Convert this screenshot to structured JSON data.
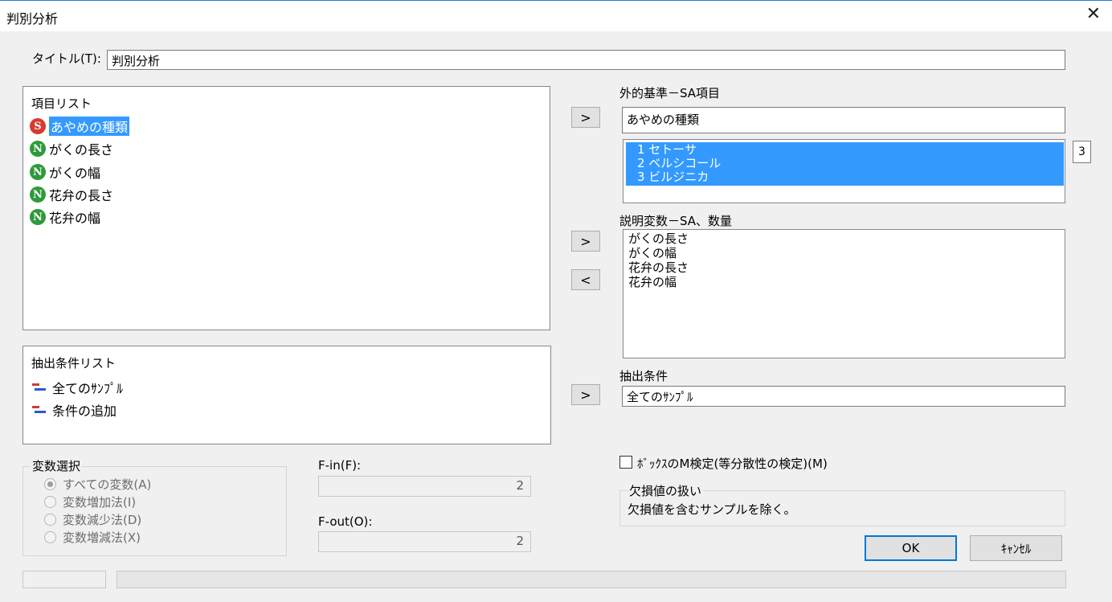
{
  "window": {
    "title": "判別分析",
    "close_glyph": "✕"
  },
  "title_field": {
    "label": "タイトル(T):",
    "value": "判別分析"
  },
  "item_list": {
    "header": "項目リスト",
    "items": [
      {
        "label": "あやめの種類",
        "badge": "S",
        "selected": true
      },
      {
        "label": "がくの長さ",
        "badge": "N"
      },
      {
        "label": "がくの幅",
        "badge": "N"
      },
      {
        "label": "花弁の長さ",
        "badge": "N"
      },
      {
        "label": "花弁の幅",
        "badge": "N"
      }
    ]
  },
  "criterion": {
    "label": "外的基準－SA項目",
    "value": "あやめの種類",
    "categories": [
      "1 セトーサ",
      "2 ベルシコール",
      "3 ビルジニカ"
    ],
    "count": "3"
  },
  "explanatory": {
    "label": "説明変数－SA、数量",
    "items": [
      "がくの長さ",
      "がくの幅",
      "花弁の長さ",
      "花弁の幅"
    ]
  },
  "condition_list": {
    "header": "抽出条件リスト",
    "items": [
      "全てのｻﾝﾌﾟﾙ",
      "条件の追加"
    ]
  },
  "condition": {
    "label": "抽出条件",
    "value": "全てのｻﾝﾌﾟﾙ"
  },
  "arrows": {
    "right": ">",
    "left": "<"
  },
  "var_select": {
    "label": "変数選択",
    "options": [
      "すべての変数(A)",
      "変数増加法(I)",
      "変数減少法(D)",
      "変数増減法(X)"
    ]
  },
  "f_in": {
    "label": "F-in(F):",
    "value": "2"
  },
  "f_out": {
    "label": "F-out(O):",
    "value": "2"
  },
  "box_m": {
    "label": "ﾎﾞｯｸｽのM検定(等分散性の検定)(M)"
  },
  "missing": {
    "label": "欠損値の扱い",
    "value": "欠損値を含むサンプルを除く。"
  },
  "buttons": {
    "ok": "OK",
    "cancel": "ｷｬﾝｾﾙ"
  },
  "colors": {
    "selection": "#3399ff",
    "accent": "#0078d7",
    "badge_s": "#d83b2e",
    "badge_n": "#2e9a3a"
  }
}
